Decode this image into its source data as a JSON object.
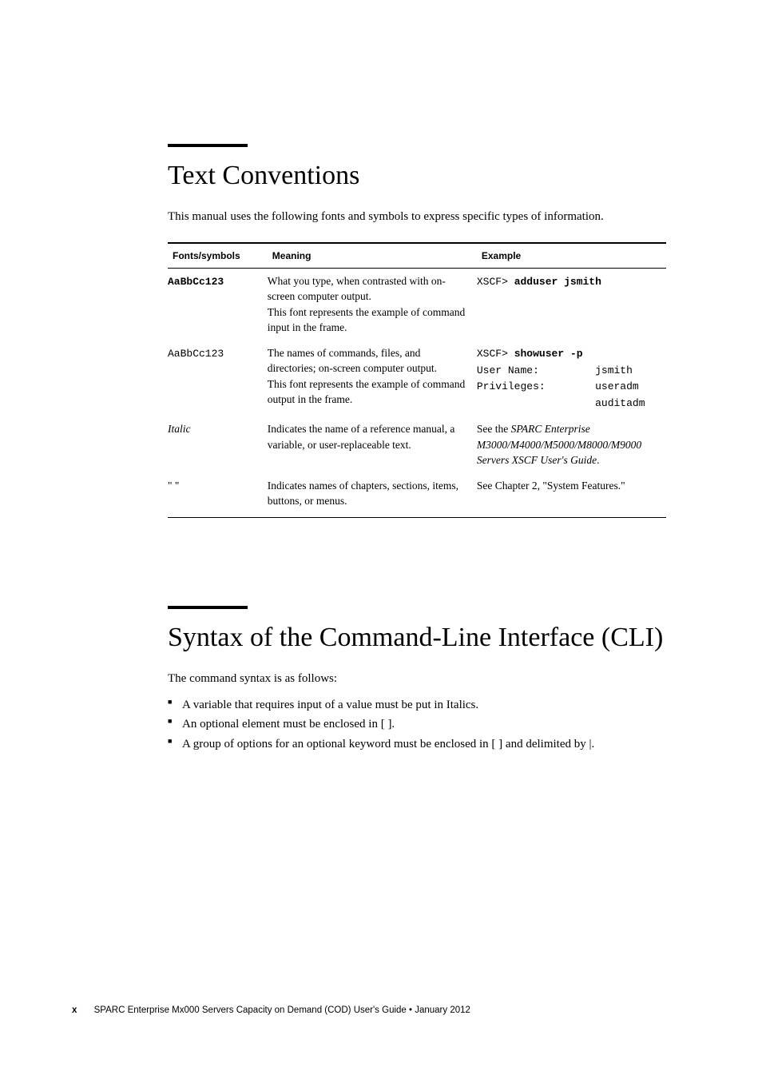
{
  "section1": {
    "title": "Text Conventions",
    "intro": "This manual uses the following fonts and symbols to express specific types of information."
  },
  "table": {
    "headers": {
      "c1": "Fonts/symbols",
      "c2": "Meaning",
      "c3": "Example"
    },
    "rows": [
      {
        "font_html": "<span class=\"mono-bold\">AaBbCc123</span>",
        "meaning_html": "What you type, when contrasted with on-screen computer output.<br>This font represents the example of command input in the frame.",
        "example_html": "<span class=\"mono\">XSCF&gt; </span><span class=\"mono-bold\">adduser jsmith</span>"
      },
      {
        "font_html": "<span class=\"mono\">AaBbCc123</span>",
        "meaning_html": "The names of commands, files, and directories; on-screen computer output.<br>This font represents the example of command output in the frame.",
        "example_html": "<span class=\"mono\">XSCF&gt; </span><span class=\"mono-bold\">showuser -p</span><br><span class=\"mono ws-pre\">User Name:         jsmith</span><br><span class=\"mono ws-pre\">Privileges:        useradm</span><br><span class=\"mono ws-pre\">                   auditadm</span>"
      },
      {
        "font_html": "<span class=\"italic\">Italic</span>",
        "meaning_html": "Indicates the name of a reference manual, a variable, or user-replaceable text.",
        "example_html": "See the <span class=\"italic\">SPARC Enterprise M3000/M4000/M5000/M8000/M9000 Servers XSCF User's Guide</span>."
      },
      {
        "font_html": "\" \"",
        "meaning_html": "Indicates names of chapters, sections, items, buttons, or menus.",
        "example_html": "See Chapter 2, \"System Features.\""
      }
    ]
  },
  "section2": {
    "title": "Syntax of the Command-Line Interface (CLI)",
    "intro": "The command syntax is as follows:",
    "bullets": [
      "A variable that requires input of a value must be put in Italics.",
      "An optional element must be enclosed in [ ].",
      "A group of options for an optional keyword must be enclosed in [ ] and delimited by |."
    ]
  },
  "footer": {
    "page": "x",
    "text": "SPARC Enterprise Mx000 Servers Capacity on Demand (COD) User's Guide • January 2012"
  }
}
